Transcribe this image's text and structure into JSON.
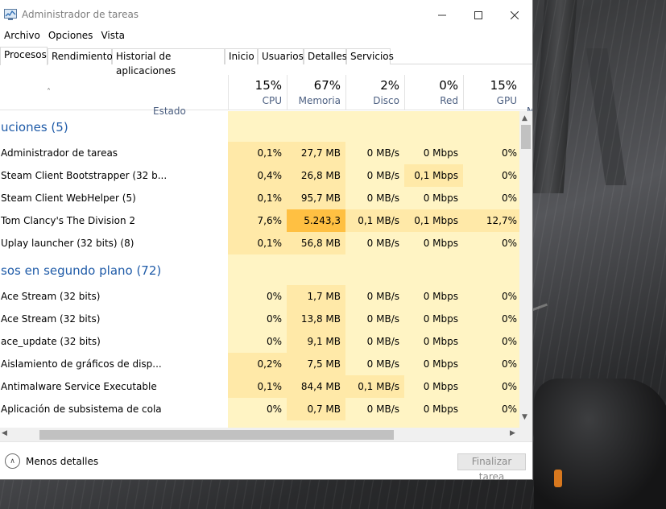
{
  "window": {
    "title": "Administrador de tareas"
  },
  "menu": [
    "Archivo",
    "Opciones",
    "Vista"
  ],
  "tabs": [
    "Procesos",
    "Rendimiento",
    "Historial de aplicaciones",
    "Inicio",
    "Usuarios",
    "Detalles",
    "Servicios"
  ],
  "active_tab": "Procesos",
  "columns": {
    "estado": "Estado",
    "cpu": {
      "pct": "15%",
      "label": "CPU"
    },
    "memoria": {
      "pct": "67%",
      "label": "Memoria"
    },
    "disco": {
      "pct": "2%",
      "label": "Disco"
    },
    "red": {
      "pct": "0%",
      "label": "Red"
    },
    "gpu": {
      "pct": "15%",
      "label": "GPU"
    },
    "extra_label": "M"
  },
  "groups": [
    {
      "title": "uciones (5)",
      "rows": [
        {
          "name": "Administrador de tareas",
          "cpu": "0,1%",
          "mem": "27,7 MB",
          "disk": "0 MB/s",
          "net": "0 Mbps",
          "gpu": "0%"
        },
        {
          "name": "Steam Client Bootstrapper (32 b...",
          "cpu": "0,4%",
          "mem": "26,8 MB",
          "disk": "0 MB/s",
          "net": "0,1 Mbps",
          "gpu": "0%"
        },
        {
          "name": "Steam Client WebHelper (5)",
          "cpu": "0,1%",
          "mem": "95,7 MB",
          "disk": "0 MB/s",
          "net": "0 Mbps",
          "gpu": "0%"
        },
        {
          "name": "Tom Clancy's The Division 2",
          "cpu": "7,6%",
          "mem": "5.243,3 MB",
          "disk": "0,1 MB/s",
          "net": "0,1 Mbps",
          "gpu": "12,7%"
        },
        {
          "name": "Uplay launcher (32 bits) (8)",
          "cpu": "0,1%",
          "mem": "56,8 MB",
          "disk": "0 MB/s",
          "net": "0 Mbps",
          "gpu": "0%"
        }
      ]
    },
    {
      "title": "sos en segundo plano (72)",
      "rows": [
        {
          "name": "Ace Stream (32 bits)",
          "cpu": "0%",
          "mem": "1,7 MB",
          "disk": "0 MB/s",
          "net": "0 Mbps",
          "gpu": "0%"
        },
        {
          "name": "Ace Stream (32 bits)",
          "cpu": "0%",
          "mem": "13,8 MB",
          "disk": "0 MB/s",
          "net": "0 Mbps",
          "gpu": "0%"
        },
        {
          "name": "ace_update (32 bits)",
          "cpu": "0%",
          "mem": "9,1 MB",
          "disk": "0 MB/s",
          "net": "0 Mbps",
          "gpu": "0%"
        },
        {
          "name": "Aislamiento de gráficos de disp...",
          "cpu": "0,2%",
          "mem": "7,5 MB",
          "disk": "0 MB/s",
          "net": "0 Mbps",
          "gpu": "0%"
        },
        {
          "name": "Antimalware Service Executable",
          "cpu": "0,1%",
          "mem": "84,4 MB",
          "disk": "0,1 MB/s",
          "net": "0 Mbps",
          "gpu": "0%"
        },
        {
          "name": "Aplicación de subsistema de cola",
          "cpu": "0%",
          "mem": "0,7 MB",
          "disk": "0 MB/s",
          "net": "0 Mbps",
          "gpu": "0%"
        }
      ]
    }
  ],
  "footer": {
    "less_details": "Menos detalles",
    "end_task": "Finalizar tarea"
  },
  "colors": {
    "light": "#fff4c4",
    "mid": "#ffe9a8",
    "hot": "#ffc042",
    "group_title": "#1f5ba8",
    "header_label": "#4d6082"
  }
}
